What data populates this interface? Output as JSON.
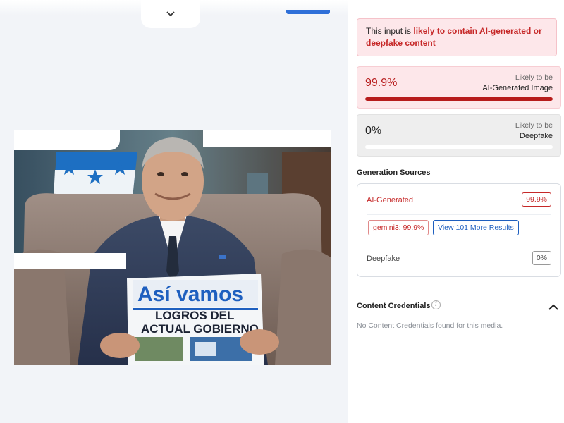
{
  "results": {
    "banner": {
      "prefix": "This input is ",
      "highlight_1": "likely to contain AI-generated or",
      "highlight_2": "deepfake content"
    },
    "ai_generated_card": {
      "percent": "99.9%",
      "label_line1": "Likely to be",
      "label_line2": "AI-Generated Image",
      "level": 0.999,
      "color": "#b71c1c"
    },
    "deepfake_card": {
      "percent": "0%",
      "label_line1": "Likely to be",
      "label_line2": "Deepfake",
      "level": 0.0
    },
    "generation_sources": {
      "title": "Generation Sources",
      "ai_label": "AI-Generated",
      "ai_badge": "99.9%",
      "model_chip": "gemini3: 99.9%",
      "more_button": "View 101 More Results",
      "deepfake_label": "Deepfake",
      "deepfake_badge": "0%"
    },
    "content_credentials": {
      "title": "Content Credentials",
      "info_icon": "info-icon",
      "toggle_icon": "chevron-up-icon",
      "message": "No Content Credentials found for this media."
    }
  },
  "preview": {
    "toggle_icon": "chevron-down-icon",
    "newspaper_headline": "Así vamos",
    "newspaper_subhead_1": "LOGROS DEL",
    "newspaper_subhead_2": "ACTUAL GOBIERNO"
  },
  "colors": {
    "accent_red": "#c62828",
    "link_blue": "#1e5fbf",
    "alert_bg": "#fde7ea"
  }
}
